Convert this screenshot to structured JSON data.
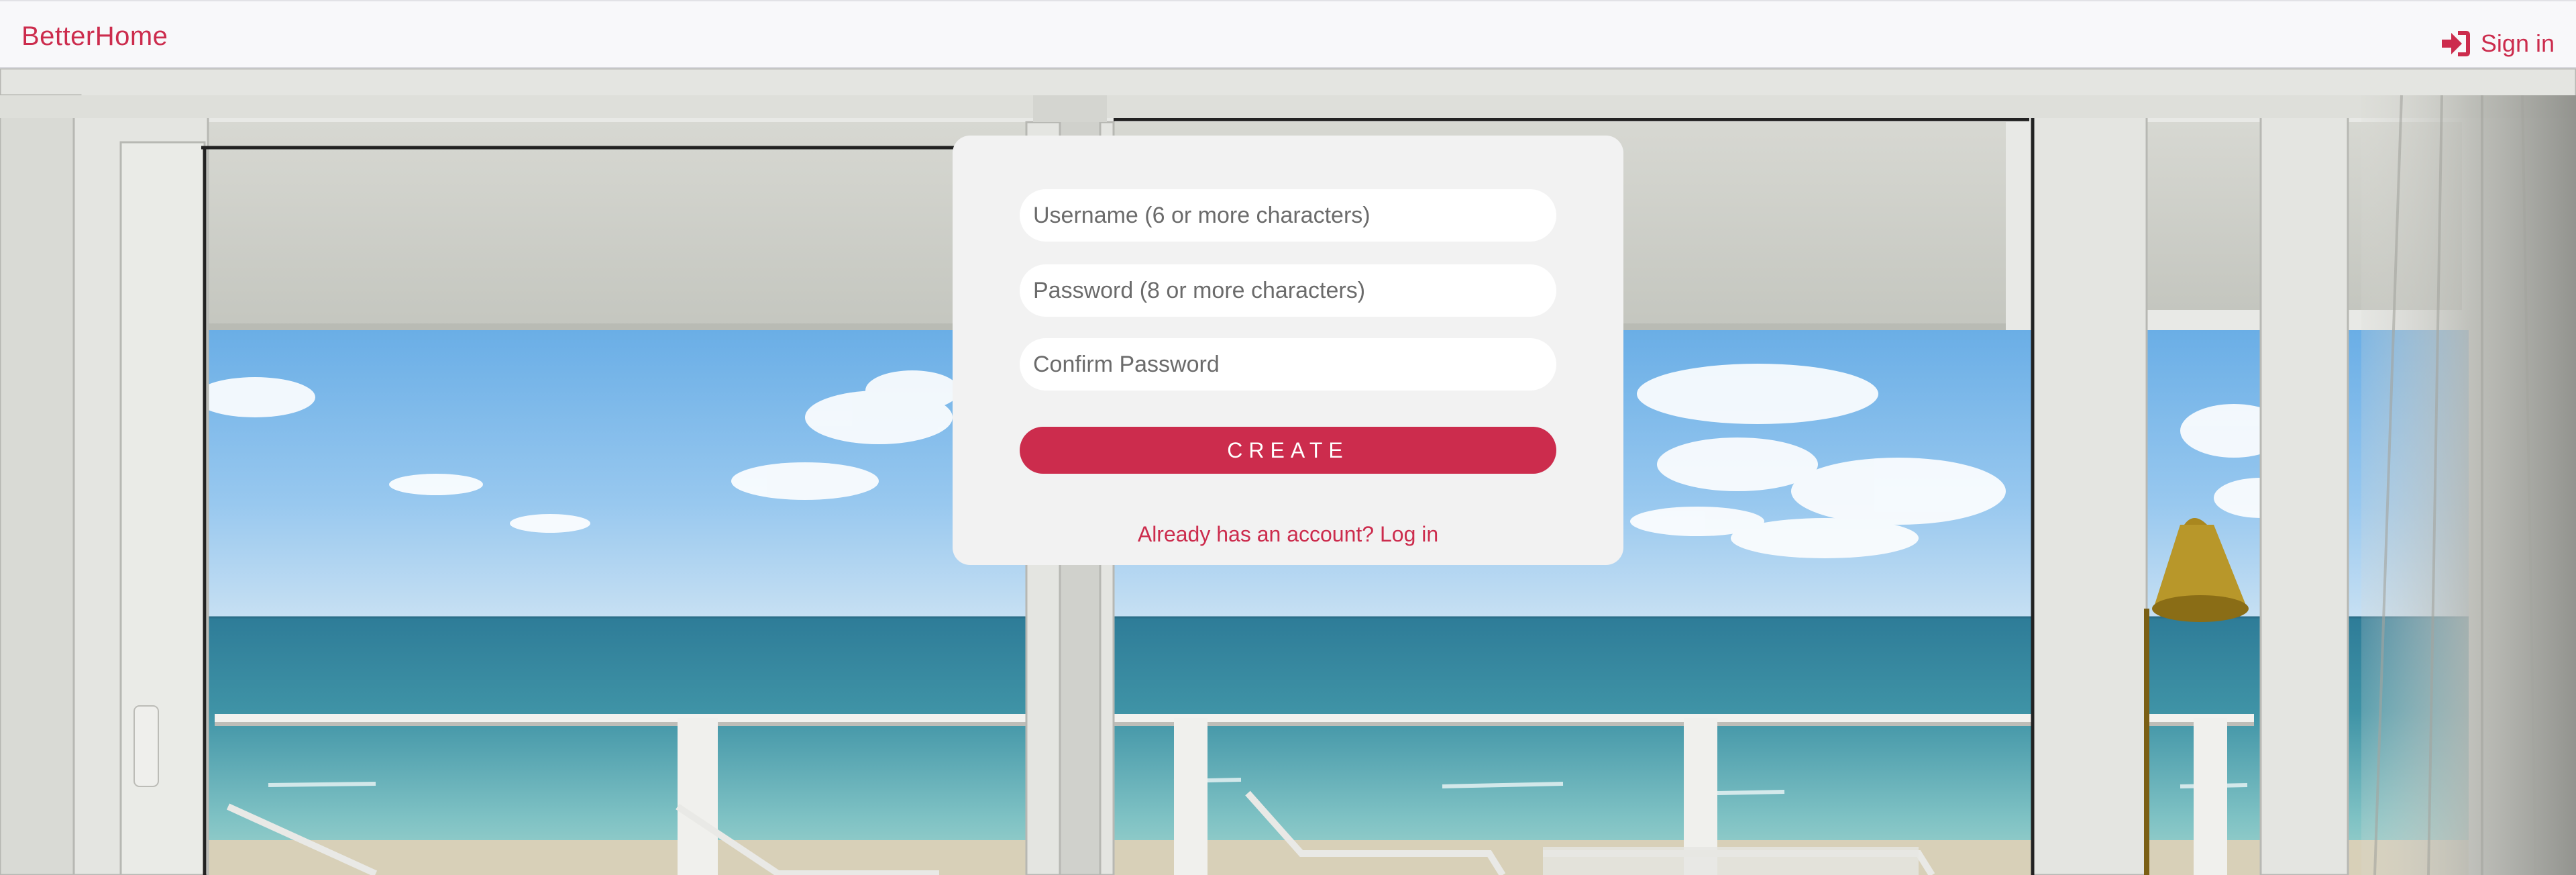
{
  "navbar": {
    "brand": "BetterHome",
    "signin_label": "Sign in",
    "signin_icon": "sign-in-arrow-icon",
    "accent_color": "#cc2c4d"
  },
  "signup_form": {
    "username_placeholder": "Username (6 or more characters)",
    "password_placeholder": "Password (8 or more characters)",
    "confirm_placeholder": "Confirm Password",
    "create_label": "CREATE",
    "login_link": "Already has an account? Log in"
  }
}
